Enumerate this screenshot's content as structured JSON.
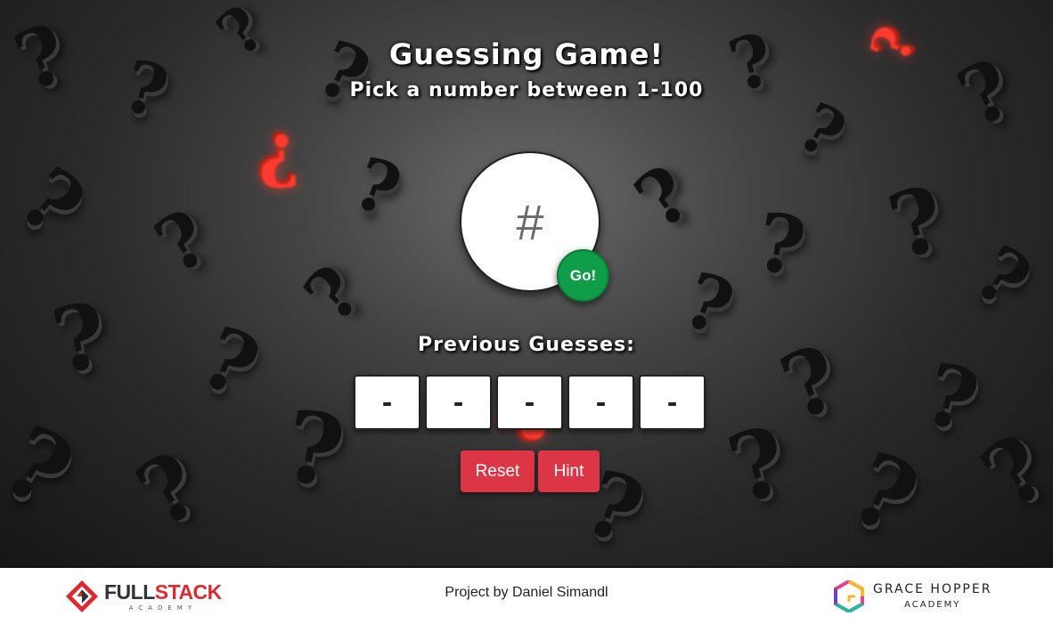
{
  "game": {
    "title": "Guessing Game!",
    "subtitle": "Pick a number between 1-100",
    "guess_placeholder": "#",
    "go_label": "Go!",
    "previous_label": "Previous Guesses:",
    "previous_guesses": [
      "-",
      "-",
      "-",
      "-",
      "-"
    ],
    "reset_label": "Reset",
    "hint_label": "Hint"
  },
  "footer": {
    "fullstack": {
      "name_part1": "FULL",
      "name_part2": "STACK",
      "sub": "ACADEMY",
      "icon": "fullstack-logo-icon"
    },
    "credit": "Project by Daniel Simandl",
    "grace_hopper": {
      "name": "GRACE HOPPER",
      "sub": "ACADEMY",
      "icon": "grace-hopper-logo-icon"
    }
  },
  "colors": {
    "go": "#0f9d4a",
    "action_buttons": "#dc3545",
    "fullstack_red": "#e0282e",
    "background_dark": "#1f1f1f"
  }
}
